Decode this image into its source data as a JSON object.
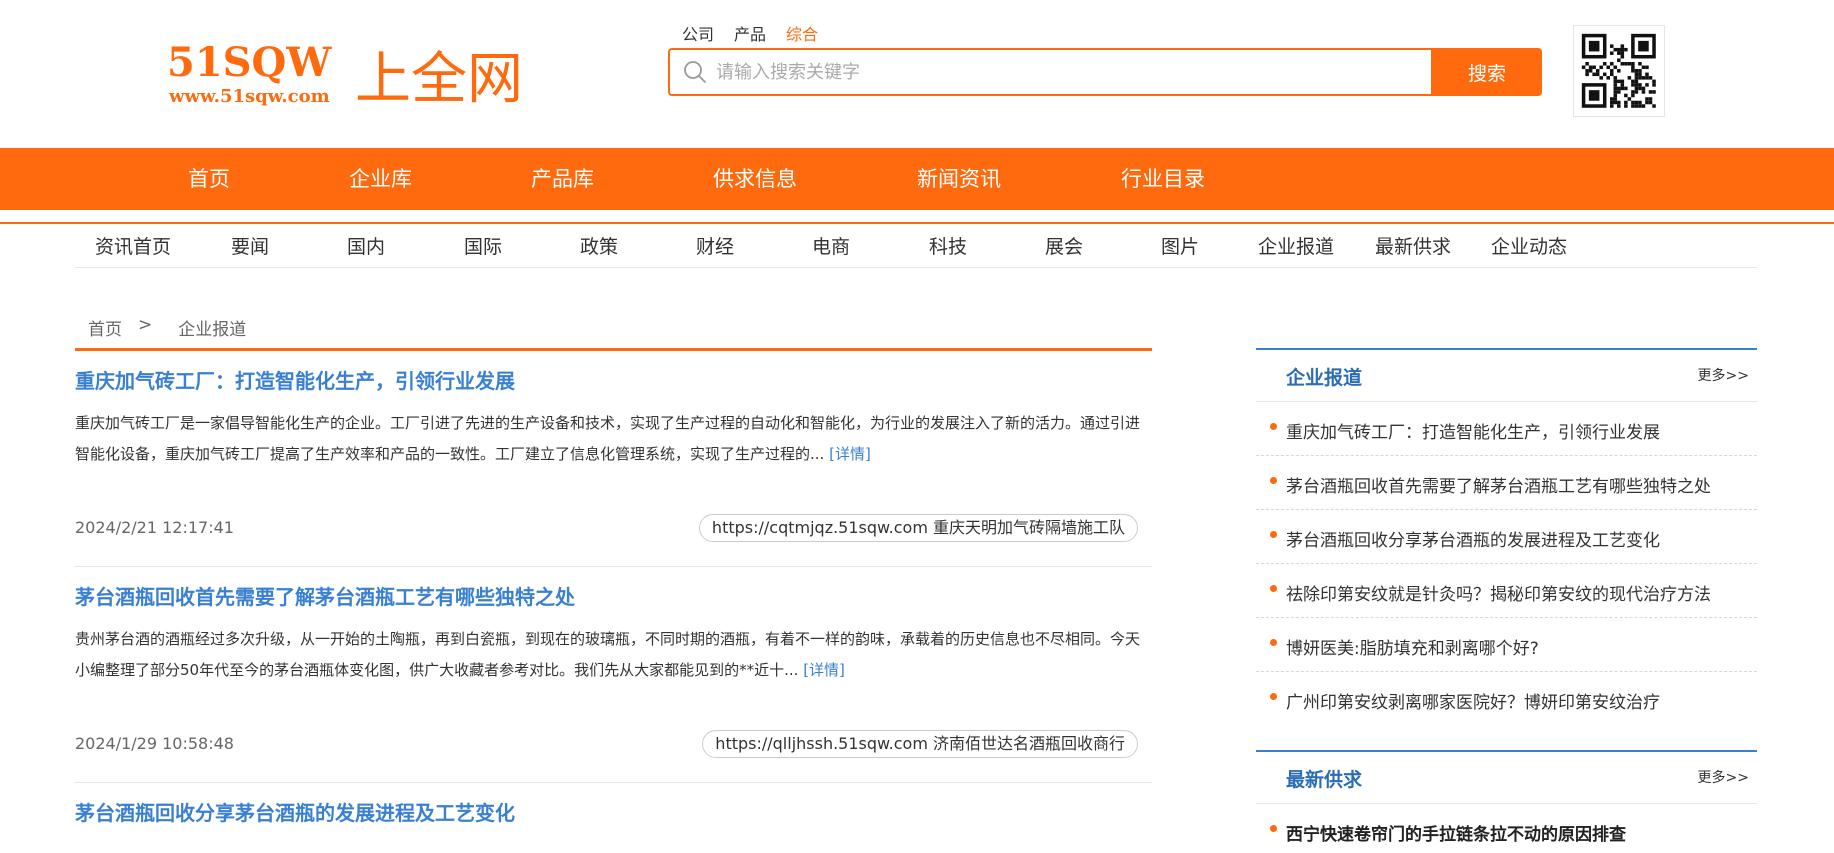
{
  "logo": {
    "brand": "51SQW",
    "url": "www.51sqw.com",
    "cn": "上全网"
  },
  "search": {
    "types": [
      "公司",
      "产品",
      "综合"
    ],
    "active_type": "综合",
    "placeholder": "请输入搜索关键字",
    "value": "",
    "button": "搜索"
  },
  "main_nav": [
    "首页",
    "企业库",
    "产品库",
    "供求信息",
    "新闻资讯",
    "行业目录"
  ],
  "sub_nav": [
    "资讯首页",
    "要闻",
    "国内",
    "国际",
    "政策",
    "财经",
    "电商",
    "科技",
    "展会",
    "图片",
    "企业报道",
    "最新供求",
    "企业动态"
  ],
  "breadcrumb": {
    "home": "首页",
    "sep": ">",
    "current": "企业报道"
  },
  "articles": [
    {
      "title": "重庆加气砖工厂：打造智能化生产，引领行业发展",
      "summary": "重庆加气砖工厂是一家倡导智能化生产的企业。工厂引进了先进的生产设备和技术，实现了生产过程的自动化和智能化，为行业的发展注入了新的活力。通过引进智能化设备，重庆加气砖工厂提高了生产效率和产品的一致性。工厂建立了信息化管理系统，实现了生产过程的...",
      "detail": "[详情]",
      "date": "2024/2/21 12:17:41",
      "source": "https://cqtmjqz.51sqw.com 重庆天明加气砖隔墙施工队"
    },
    {
      "title": "茅台酒瓶回收首先需要了解茅台酒瓶工艺有哪些独特之处",
      "summary": "贵州茅台酒的酒瓶经过多次升级，从一开始的土陶瓶，再到白瓷瓶，到现在的玻璃瓶，不同时期的酒瓶，有着不一样的韵味，承载着的历史信息也不尽相同。今天小编整理了部分50年代至今的茅台酒瓶体变化图，供广大收藏者参考对比。我们先从大家都能见到的**近十...",
      "detail": "[详情]",
      "date": "2024/1/29 10:58:48",
      "source": "https://qlljhssh.51sqw.com 济南佰世达名酒瓶回收商行"
    },
    {
      "title": "茅台酒瓶回收分享茅台酒瓶的发展进程及工艺变化"
    }
  ],
  "sidebar": {
    "reports": {
      "title": "企业报道",
      "more": "更多>>",
      "items": [
        "重庆加气砖工厂：打造智能化生产，引领行业发展",
        "茅台酒瓶回收首先需要了解茅台酒瓶工艺有哪些独特之处",
        "茅台酒瓶回收分享茅台酒瓶的发展进程及工艺变化",
        "祛除印第安纹就是针灸吗？揭秘印第安纹的现代治疗方法",
        "博妍医美:脂肪填充和剥离哪个好?",
        "广州印第安纹剥离哪家医院好？博妍印第安纹治疗"
      ]
    },
    "supply": {
      "title": "最新供求",
      "more": "更多>>",
      "items": [
        "西宁快速卷帘门的手拉链条拉不动的原因排查"
      ]
    }
  },
  "colors": {
    "accent": "#ff6a0e",
    "link": "#3a80d2",
    "sidebar_border": "#3a80d2"
  }
}
